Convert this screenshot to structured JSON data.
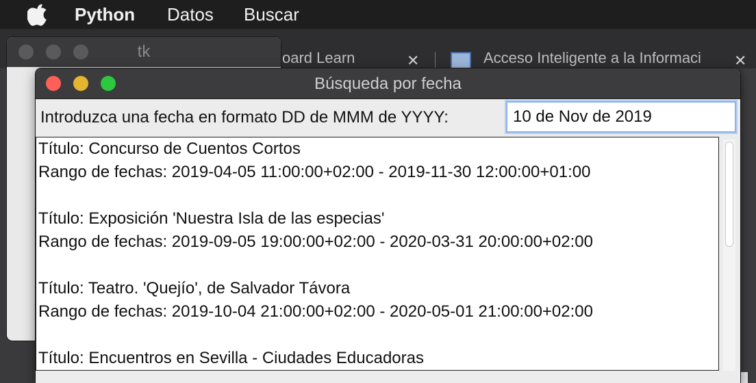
{
  "menubar": {
    "app_name": "Python",
    "items": [
      "Datos",
      "Buscar"
    ]
  },
  "background_browser": {
    "tabs": [
      {
        "label": "oard Learn",
        "close": "✕"
      },
      {
        "label": "Acceso Inteligente a la Informaci",
        "close": "✕"
      }
    ]
  },
  "tk_window": {
    "title": "tk"
  },
  "dialog": {
    "title": "Búsqueda por fecha",
    "prompt_label": "Introduzca una fecha en formato DD de MMM de YYYY:",
    "date_input_value": "10 de Nov de 2019",
    "results": [
      {
        "title": "Título: Concurso de Cuentos Cortos",
        "range": "Rango de fechas: 2019-04-05 11:00:00+02:00 - 2019-11-30 12:00:00+01:00"
      },
      {
        "title": "Título: Exposición 'Nuestra Isla de las especias'",
        "range": "Rango de fechas: 2019-09-05 19:00:00+02:00 - 2020-03-31 20:00:00+02:00"
      },
      {
        "title": "Título: Teatro. 'Quejío', de Salvador Távora",
        "range": "Rango de fechas: 2019-10-04 21:00:00+02:00 - 2020-05-01 21:00:00+02:00"
      },
      {
        "title": "Título: Encuentros en Sevilla - Ciudades Educadoras",
        "range": ""
      }
    ]
  },
  "colors": {
    "close_button": "#fe5f57",
    "minimize_button": "#e6b52f",
    "zoom_button": "#2bc840",
    "input_focus_ring": "#8db3e8"
  }
}
